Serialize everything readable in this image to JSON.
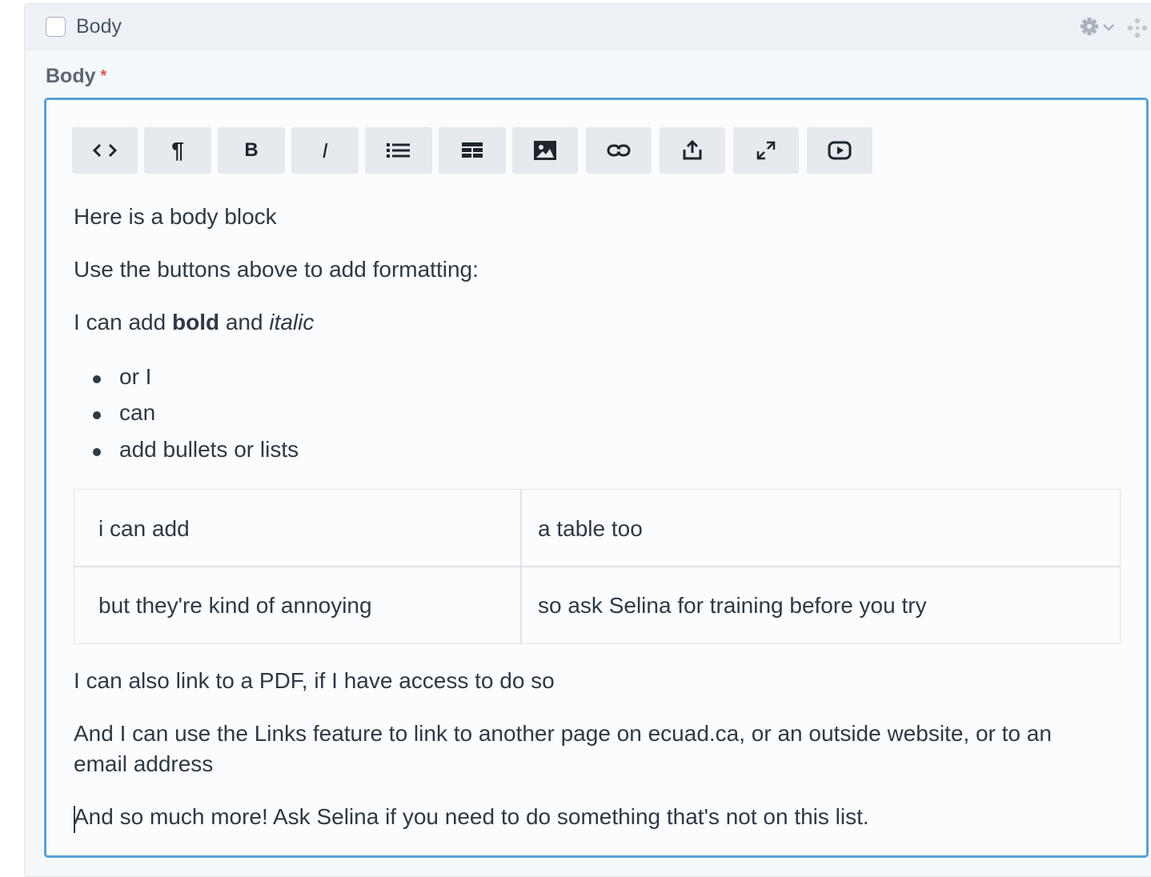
{
  "block": {
    "header_title": "Body",
    "gear_icon": "gear-icon",
    "drag_icon": "drag-handle-icon"
  },
  "field": {
    "label": "Body",
    "required_marker": "*"
  },
  "toolbar": {
    "buttons": [
      {
        "name": "source-code-button",
        "icon": "code-icon"
      },
      {
        "name": "paragraph-button",
        "icon": "pilcrow-icon",
        "label": "¶"
      },
      {
        "name": "bold-button",
        "icon": "bold-icon",
        "label": "B"
      },
      {
        "name": "italic-button",
        "icon": "italic-icon",
        "label": "I"
      },
      {
        "name": "bullet-list-button",
        "icon": "list-icon"
      },
      {
        "name": "table-button",
        "icon": "table-icon"
      },
      {
        "name": "image-button",
        "icon": "image-icon"
      },
      {
        "name": "link-button",
        "icon": "link-icon"
      },
      {
        "name": "upload-button",
        "icon": "share-icon"
      },
      {
        "name": "fullscreen-button",
        "icon": "expand-icon"
      },
      {
        "name": "video-embed-button",
        "icon": "play-icon"
      }
    ]
  },
  "content": {
    "p1": "Here is a body block",
    "p2": "Use the buttons above to add formatting:",
    "p3_prefix": "I can add ",
    "p3_bold": "bold",
    "p3_middle": " and ",
    "p3_italic": "italic",
    "bullets": [
      "or I",
      "can",
      "add bullets or lists"
    ],
    "table": [
      [
        "i can add",
        "a table too"
      ],
      [
        "but they're kind of annoying",
        "so ask Selina for training before you try"
      ]
    ],
    "p4": "I can also link to a PDF, if I have access to do so",
    "p5_line1": "And I can use the Links feature to link to another page on ecuad.ca, or an outside website, or to an",
    "p5_line2": "email address",
    "p6": "And so much more! Ask Selina if you need to do something that's not on this list."
  },
  "colors": {
    "panel_bg": "#f5f8fb",
    "header_bg": "#eef2f7",
    "editor_border": "#5a9fd6",
    "button_bg": "#e6e9ed",
    "required": "#d9534f",
    "text": "#2f3944"
  }
}
